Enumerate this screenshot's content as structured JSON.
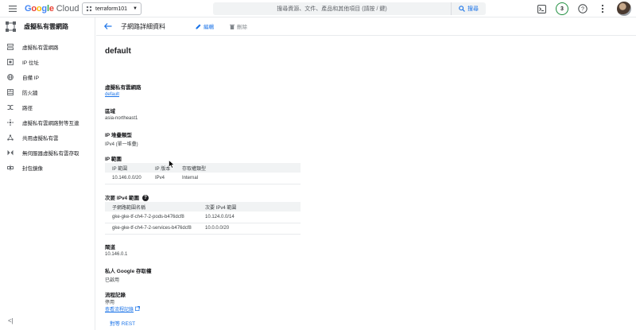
{
  "topbar": {
    "logo_google": "Google",
    "logo_cloud": "Cloud",
    "project_name": "terraform101",
    "search_placeholder": "搜尋資源、文件、產品和其他項目 (請按 / 鍵)",
    "search_button": "搜尋",
    "notification_count": "3",
    "icons": [
      "menu-icon",
      "project-icon",
      "search-icon",
      "cloud-shell-icon",
      "help-icon",
      "more-icon"
    ]
  },
  "sidebar": {
    "title": "虛擬私有雲網路",
    "items": [
      {
        "label": "虛擬私有雲網路",
        "icon": "vpc-network-icon"
      },
      {
        "label": "IP 位址",
        "icon": "ip-address-icon"
      },
      {
        "label": "自備 IP",
        "icon": "byoip-icon"
      },
      {
        "label": "防火牆",
        "icon": "firewall-icon"
      },
      {
        "label": "路徑",
        "icon": "routes-icon"
      },
      {
        "label": "虛擬私有雲網路對等互連",
        "icon": "peering-icon"
      },
      {
        "label": "共用虛擬私有雲",
        "icon": "shared-vpc-icon"
      },
      {
        "label": "無伺服器虛擬私有雲存取",
        "icon": "serverless-access-icon"
      },
      {
        "label": "封包鏡像",
        "icon": "packet-mirroring-icon"
      }
    ],
    "collapse_label": "<|"
  },
  "header": {
    "title": "子網路詳細資料",
    "edit_label": "編輯",
    "delete_label": "刪除"
  },
  "details": {
    "name": "default",
    "vpc_label": "虛擬私有雲網路",
    "vpc_value": "default",
    "region_label": "區域",
    "region_value": "asia-northeast1",
    "stack_label": "IP 堆疊類型",
    "stack_value": "IPv4 (單一堆疊)",
    "ip_range_label": "IP 範圍",
    "ip_table": {
      "headers": [
        "IP 範圍",
        "IP 版本",
        "存取權類型"
      ],
      "rows": [
        [
          "10.146.0.0/20",
          "IPv4",
          "Internal"
        ]
      ]
    },
    "secondary_label": "次要 IPv4 範圍",
    "secondary_table": {
      "headers": [
        "子網路範圍名稱",
        "次要 IPv4 範圍"
      ],
      "rows": [
        [
          "gke-gke-tf-ch4-7-2-pods-b476dcf8",
          "10.124.0.0/14"
        ],
        [
          "gke-gke-tf-ch4-7-2-services-b476dcf8",
          "10.0.0.0/20"
        ]
      ]
    },
    "gateway_label": "閘道",
    "gateway_value": "10.146.0.1",
    "private_access_label": "私人 Google 存取權",
    "private_access_value": "已啟用",
    "flow_logs_label": "流程記錄",
    "flow_logs_value": "停用",
    "flow_logs_link": "查看流程記錄",
    "rest_label": "對等 REST"
  }
}
